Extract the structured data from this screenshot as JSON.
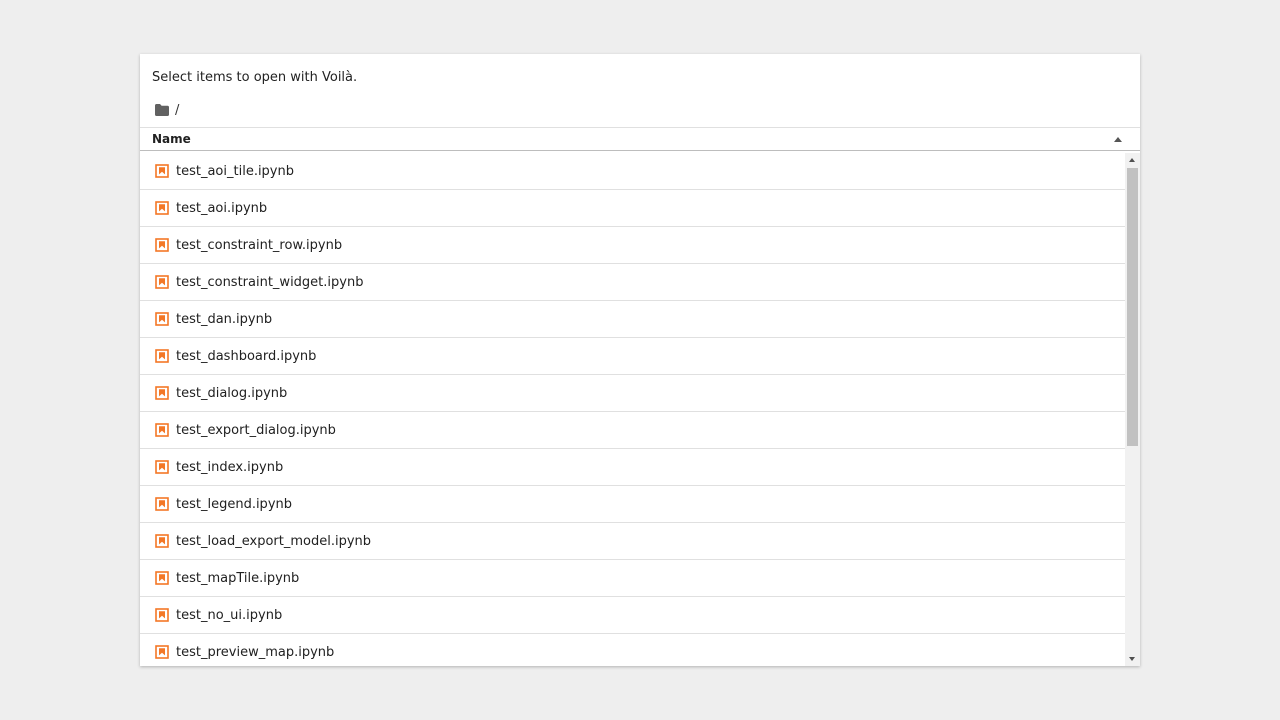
{
  "intro_text": "Select items to open with Voilà.",
  "breadcrumbs": {
    "icon": "folder-icon",
    "path": "/"
  },
  "listing_header": {
    "name_label": "Name",
    "sort": "ascending"
  },
  "items": [
    {
      "name": "test_aoi_tile.ipynb",
      "icon": "notebook-icon"
    },
    {
      "name": "test_aoi.ipynb",
      "icon": "notebook-icon"
    },
    {
      "name": "test_constraint_row.ipynb",
      "icon": "notebook-icon"
    },
    {
      "name": "test_constraint_widget.ipynb",
      "icon": "notebook-icon"
    },
    {
      "name": "test_dan.ipynb",
      "icon": "notebook-icon"
    },
    {
      "name": "test_dashboard.ipynb",
      "icon": "notebook-icon"
    },
    {
      "name": "test_dialog.ipynb",
      "icon": "notebook-icon"
    },
    {
      "name": "test_export_dialog.ipynb",
      "icon": "notebook-icon"
    },
    {
      "name": "test_index.ipynb",
      "icon": "notebook-icon"
    },
    {
      "name": "test_legend.ipynb",
      "icon": "notebook-icon"
    },
    {
      "name": "test_load_export_model.ipynb",
      "icon": "notebook-icon"
    },
    {
      "name": "test_mapTile.ipynb",
      "icon": "notebook-icon"
    },
    {
      "name": "test_no_ui.ipynb",
      "icon": "notebook-icon"
    },
    {
      "name": "test_preview_map.ipynb",
      "icon": "notebook-icon"
    }
  ],
  "colors": {
    "notebook_icon": "#f37726",
    "folder_icon": "#616161",
    "background": "#eeeeee",
    "panel": "#ffffff"
  }
}
